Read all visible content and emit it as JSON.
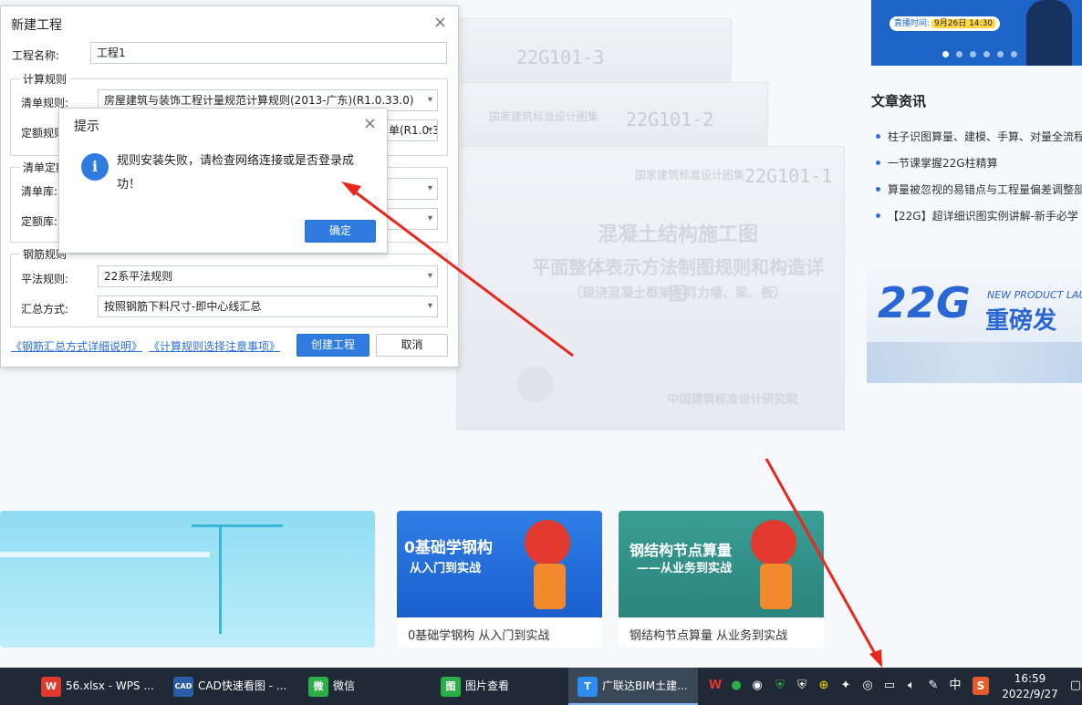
{
  "new_project_dialog": {
    "title": "新建工程",
    "project_name_label": "工程名称:",
    "project_name_value": "工程1",
    "calc_rules_group": "计算规则",
    "bill_rule_label": "清单规则:",
    "bill_rule_value": "房屋建筑与装饰工程计量规范计算规则(2013-广东)(R1.0.33.0)",
    "quota_rule_label": "定额规则:",
    "quota_rule_value_partial": "单(R1.0.3",
    "bill_quota_group": "清单定额",
    "bill_lib_label": "清单库:",
    "quota_lib_label": "定额库:",
    "rebar_group": "钢筋规则",
    "flat_rule_label": "平法规则:",
    "flat_rule_value": "22系平法规则",
    "summary_label": "汇总方式:",
    "summary_value": "按照钢筋下料尺寸-即中心线汇总",
    "link1": "《钢筋汇总方式详细说明》",
    "link2": "《计算规则选择注意事项》",
    "create_btn": "创建工程",
    "cancel_btn": "取消"
  },
  "alert_dialog": {
    "title": "提示",
    "message": "规则安装失败，请检查网络连接或是否登录成功！",
    "ok_btn": "确定"
  },
  "background": {
    "books": [
      {
        "series": "22G101-3",
        "label": "国家建筑标准设计图集"
      },
      {
        "series": "22G101-2",
        "label": "国家建筑标准设计图集"
      },
      {
        "series": "22G101-1",
        "label": "国家建筑标准设计图集"
      }
    ],
    "book_heading_1": "混凝土结构施工图",
    "book_heading_2": "平面整体表示方法制图规则和构造详图",
    "book_heading_3": "（现浇混凝土框架、剪力墙、梁、板）",
    "book_publisher": "中国建筑标准设计研究院",
    "banner_live_label": "直播时间:",
    "banner_live_date": "9月26日 14:30",
    "news_title": "文章资讯",
    "news_items": [
      "柱子识图算量、建模、手算、对量全流程",
      "一节课掌握22G柱精算",
      "算量被忽视的易错点与工程量偏差调整部",
      "【22G】超详细识图实例讲解-新手必学"
    ],
    "promo_22g": "22G",
    "promo_text": "重磅发",
    "promo_en": "NEW PRODUCT LAU",
    "cards": [
      {
        "banner_line1": "0基础学钢构",
        "banner_line2": "从入门到实战",
        "caption": "0基础学钢构  从入门到实战"
      },
      {
        "banner_line1": "钢结构节点算量",
        "banner_line2": "——从业务到实战",
        "caption": "钢结构节点算量  从业务到实战"
      }
    ]
  },
  "taskbar": {
    "tasks": [
      {
        "label": "56.xlsx - WPS ...",
        "icon": "W"
      },
      {
        "label": "CAD快速看图 - ...",
        "icon": "CAD"
      },
      {
        "label": "微信",
        "icon": "微"
      },
      {
        "label": "图片查看",
        "icon": "图"
      },
      {
        "label": "广联达BIM土建...",
        "icon": "T"
      }
    ],
    "ime": "中",
    "time": "16:59",
    "date": "2022/9/27"
  },
  "colors": {
    "primary": "#2f7be0",
    "taskbar": "#1f2a36",
    "arrow": "#e8271e"
  }
}
